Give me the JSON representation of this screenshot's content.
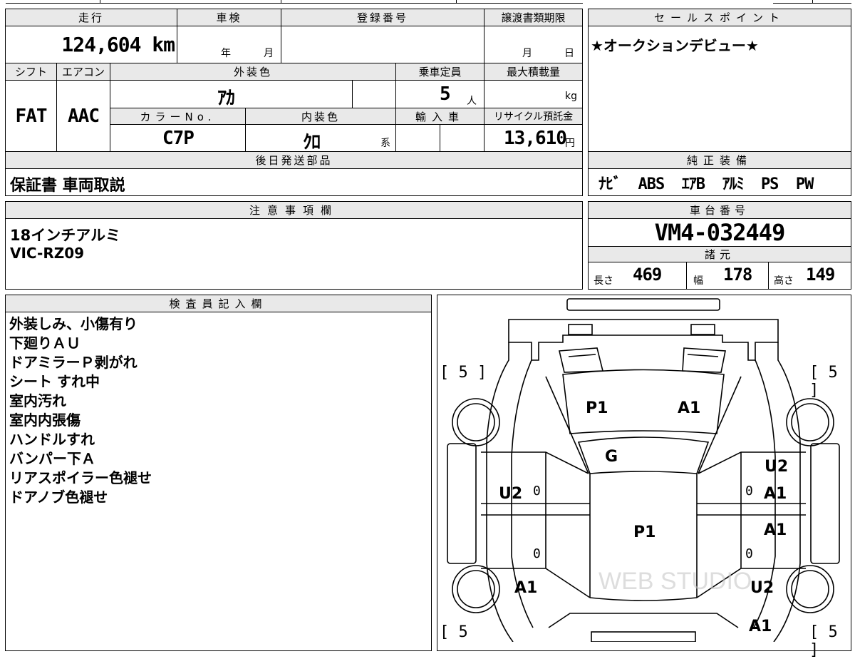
{
  "mileage": {
    "label": "走行",
    "value": "124,604 km"
  },
  "inspection": {
    "label": "車検",
    "year_unit": "年",
    "month_unit": "月"
  },
  "registration": {
    "label": "登録番号"
  },
  "transfer_deadline": {
    "label": "譲渡書類期限",
    "month_unit": "月",
    "day_unit": "日"
  },
  "shift": {
    "label": "シフト",
    "value": "FAT"
  },
  "aircon": {
    "label": "エアコン",
    "value": "AAC"
  },
  "exterior_color": {
    "label": "外装色",
    "value": "ｱｶ"
  },
  "capacity": {
    "label": "乗車定員",
    "value": "5",
    "unit": "人"
  },
  "max_load": {
    "label": "最大積載量",
    "unit": "kg"
  },
  "color_no": {
    "label": "カラーNo.",
    "value": "C7P"
  },
  "interior_color": {
    "label": "内装色",
    "value": "ｸﾛ",
    "suffix": "系"
  },
  "import": {
    "label": "輸入車"
  },
  "recycle": {
    "label": "リサイクル預託金",
    "value": "13,610",
    "unit": "円"
  },
  "later_parts": {
    "label": "後日発送部品",
    "value": "保証書 車両取説"
  },
  "sales_point": {
    "label": "セールスポイント",
    "value": "★オークションデビュー★"
  },
  "standard_equipment": {
    "label": "純正装備",
    "value": "ﾅﾋﾞ  ABS  ｴｱB  ｱﾙﾐ  PS  PW"
  },
  "notes": {
    "label": "注意事項欄",
    "lines": [
      "18インチアルミ",
      "VIC-RZ09"
    ]
  },
  "chassis": {
    "label": "車台番号",
    "value": "VM4-032449"
  },
  "specs": {
    "label": "諸元",
    "length_label": "長さ",
    "length": "469",
    "width_label": "幅",
    "width": "178",
    "height_label": "高さ",
    "height": "149"
  },
  "inspector": {
    "label": "検査員記入欄",
    "lines": [
      "外装しみ、小傷有り",
      "下廻りＡＵ",
      "ドアミラーＰ剥がれ",
      "シート すれ中",
      "室内汚れ",
      "室内内張傷",
      "ハンドルすれ",
      "バンパー下Ａ",
      "リアスポイラー色褪せ",
      "ドアノブ色褪せ"
    ]
  },
  "diagram": {
    "tire_tl": "[ 5 ]",
    "tire_tr": "[ 5 ]",
    "tire_bl": "[ 5",
    "tire_br": "[ 5 ]",
    "hood_left": "P1",
    "hood_right": "A1",
    "windshield": "G",
    "roof": "P1",
    "left_front_door": "U2",
    "left_front_door_zero": "0",
    "left_rear_door_zero": "0",
    "left_rear_fender": "A1",
    "right_front_fender": "U2",
    "right_front_door": "A1",
    "right_front_door_zero": "0",
    "right_rear_door": "A1",
    "right_rear_door_zero": "0",
    "right_rear_fender": "U2",
    "right_rear_bottom": "A1"
  }
}
